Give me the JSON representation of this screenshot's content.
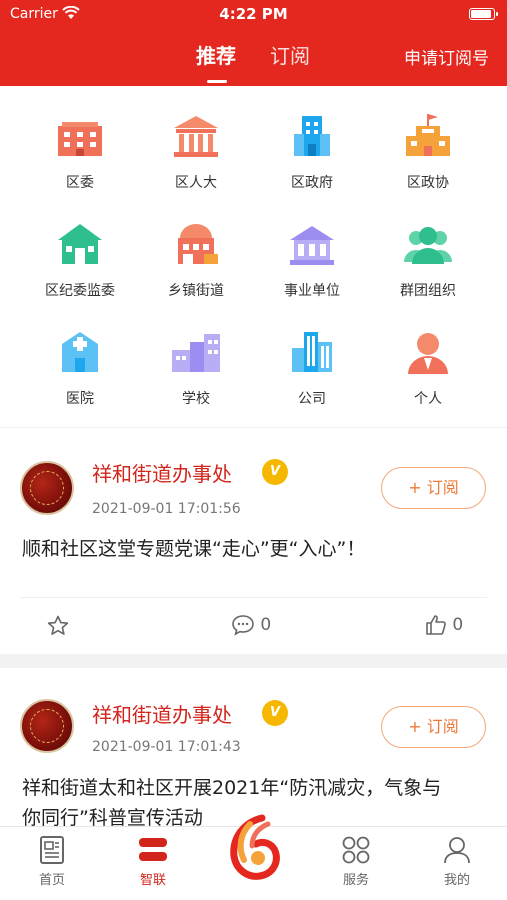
{
  "status": {
    "carrier": "Carrier",
    "time": "4:22 PM"
  },
  "header": {
    "tabs": [
      "推荐",
      "订阅"
    ],
    "apply_label": "申请订阅号"
  },
  "categories": [
    {
      "label": "区委",
      "icon": "office-building-icon"
    },
    {
      "label": "区人大",
      "icon": "government-hall-icon"
    },
    {
      "label": "区政府",
      "icon": "government-tower-icon"
    },
    {
      "label": "区政协",
      "icon": "flag-building-icon"
    },
    {
      "label": "区纪委监委",
      "icon": "home-building-icon"
    },
    {
      "label": "乡镇街道",
      "icon": "town-building-icon"
    },
    {
      "label": "事业单位",
      "icon": "institution-icon"
    },
    {
      "label": "群团组织",
      "icon": "group-people-icon"
    },
    {
      "label": "医院",
      "icon": "hospital-icon"
    },
    {
      "label": "学校",
      "icon": "school-icon"
    },
    {
      "label": "公司",
      "icon": "company-icon"
    },
    {
      "label": "个人",
      "icon": "person-icon"
    }
  ],
  "icon_colors": {
    "red": "#f0705a",
    "orange": "#f6a23a",
    "blue": "#1fa7ee",
    "teal": "#2fbf8e",
    "purple": "#9b8ef0",
    "salmon": "#f48a6a"
  },
  "feed": [
    {
      "source": "祥和街道办事处",
      "badge": "V",
      "date": "2021-09-01 17:01:56",
      "subscribe_label": "+ 订阅",
      "title": "顺和社区这堂专题党课“走心”更“入心”！",
      "comments": "0",
      "likes": "0"
    },
    {
      "source": "祥和街道办事处",
      "badge": "V",
      "date": "2021-09-01 17:01:43",
      "subscribe_label": "+ 订阅",
      "title": "祥和街道太和社区开展2021年“防汛减灾，气象与",
      "title2": "你同行”科普宣传活动"
    }
  ],
  "nav": [
    {
      "label": "首页",
      "icon": "news-icon"
    },
    {
      "label": "智联",
      "icon": "zhilian-icon"
    },
    {
      "label": "服务",
      "icon": "grid-services-icon"
    },
    {
      "label": "我的",
      "icon": "profile-icon"
    }
  ],
  "colors": {
    "brand_red": "#e4281f",
    "accent_orange": "#ee7a3a",
    "badge_gold": "#f5b700"
  }
}
